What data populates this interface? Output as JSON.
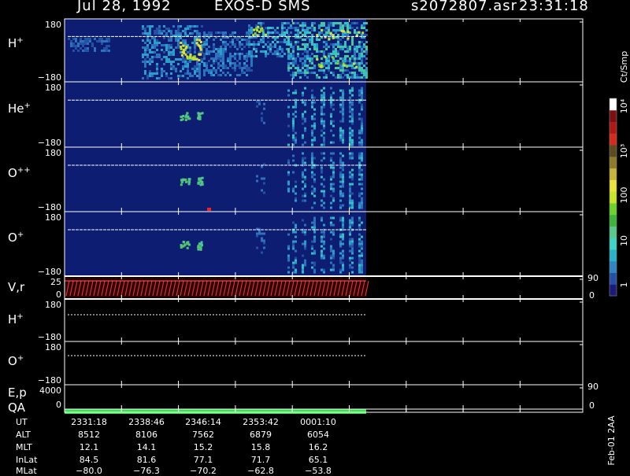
{
  "header": {
    "date": "Jul 28, 1992",
    "instrument": "EXOS-D SMS",
    "file": "s2072807.asr",
    "time": "23:31:18"
  },
  "colorbar": {
    "unit": "Ct/Smp",
    "tick_labels": [
      "10⁴",
      "10³",
      "100",
      "10",
      "1"
    ],
    "colors": [
      "#1b1b7a",
      "#2450a8",
      "#2f86c4",
      "#27b3c9",
      "#3fd3c6",
      "#59c98a",
      "#3fb43b",
      "#6cd32a",
      "#c8e52a",
      "#e9e33b",
      "#c8b43a",
      "#8f7a2a",
      "#5c4a20",
      "#d62b1c",
      "#b01818",
      "#7a1010",
      "#ffffff"
    ]
  },
  "chart_data": {
    "type": "heatmap",
    "title": "Jul 28, 1992   EXOS-D SMS",
    "x_ticks_ut": [
      "2331:18",
      "2338:46",
      "2346:14",
      "2353:42",
      "0001:10"
    ],
    "panels": [
      {
        "label": "H",
        "sup": "+",
        "ytick_top": "180",
        "ytick_bottom": "−180"
      },
      {
        "label": "He",
        "sup": "+",
        "ytick_top": "180",
        "ytick_bottom": "−180"
      },
      {
        "label": "O",
        "sup": "++",
        "ytick_top": "180",
        "ytick_bottom": "−180"
      },
      {
        "label": "O",
        "sup": "+",
        "ytick_top": "180",
        "ytick_bottom": "−180"
      },
      {
        "label": "V,r",
        "sup": "",
        "ytick_top": "25",
        "ytick_bottom": "0",
        "right_top": "90",
        "right_bottom": "0"
      },
      {
        "label": "H",
        "sup": "+",
        "ytick_top": "180",
        "ytick_bottom": "−180"
      },
      {
        "label": "O",
        "sup": "+",
        "ytick_top": "180",
        "ytick_bottom": "−180"
      },
      {
        "label": "E,p",
        "sup": "",
        "ytick_top": "4000",
        "ytick_bottom": "0",
        "right_top": "90",
        "right_bottom": "0"
      },
      {
        "label": "QA",
        "sup": ""
      }
    ],
    "ephemeris": {
      "labels": [
        "UT",
        "ALT",
        "MLT",
        "InLat",
        "MLat"
      ],
      "rows": [
        [
          "2331:18",
          "2338:46",
          "2346:14",
          "2353:42",
          "0001:10"
        ],
        [
          "8512",
          "8106",
          "7562",
          "6879",
          "6054"
        ],
        [
          "12.1",
          "14.1",
          "15.2",
          "15.8",
          "16.2"
        ],
        [
          "84.5",
          "81.6",
          "77.1",
          "71.7",
          "65.1"
        ],
        [
          "−80.0",
          "−76.3",
          "−70.2",
          "−62.8",
          "−53.8"
        ]
      ]
    },
    "footer": "Feb-01 2AA"
  }
}
